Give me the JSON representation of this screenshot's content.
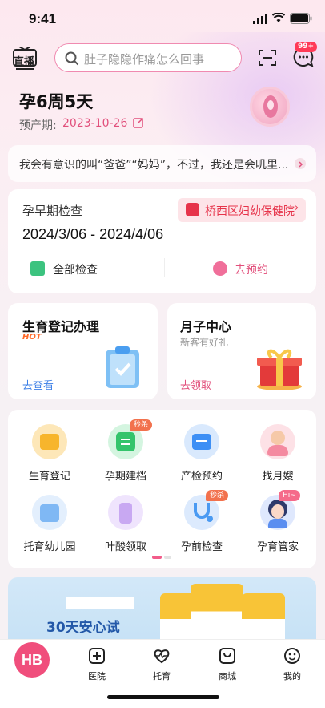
{
  "status_bar": {
    "time": "9:41"
  },
  "header": {
    "live_label": "直播",
    "search_placeholder": "肚子隐隐作痛怎么回事",
    "message_badge": "99+"
  },
  "pregnancy": {
    "week": "孕6周5天",
    "due_label": "预产期:",
    "due_date": "2023-10-26"
  },
  "tip": {
    "text": "我会有意识的叫“爸爸”“妈妈”，不过，我还是会叽里..."
  },
  "exam": {
    "title": "孕早期检查",
    "date_range": "2024/3/06 - 2024/4/06",
    "hospital": "桥西区妇幼保健院",
    "all_label": "全部检查",
    "book_label": "去预约"
  },
  "cards": [
    {
      "title": "生育登记办理",
      "tag": "HOT",
      "link": "去查看"
    },
    {
      "title": "月子中心",
      "subtitle": "新客有好礼",
      "link": "去领取"
    }
  ],
  "services": [
    {
      "label": "生育登记",
      "color": "#f7b52c",
      "icon": "registration-icon"
    },
    {
      "label": "孕期建档",
      "color": "#34c46b",
      "icon": "archive-icon",
      "tag": "秒杀"
    },
    {
      "label": "产检预约",
      "color": "#3d8ff5",
      "icon": "calendar-icon"
    },
    {
      "label": "找月嫂",
      "color": "#f4a8b4",
      "icon": "nanny-icon"
    },
    {
      "label": "托育幼儿园",
      "color": "#7fb8f4",
      "icon": "kindergarten-icon"
    },
    {
      "label": "叶酸领取",
      "color": "#c8a8f2",
      "icon": "folic-acid-icon"
    },
    {
      "label": "孕前检查",
      "color": "#4a9af2",
      "icon": "stethoscope-icon",
      "tag": "秒杀"
    },
    {
      "label": "孕育管家",
      "color": "#5b8ef0",
      "icon": "assistant-icon",
      "tag": "Hi~"
    }
  ],
  "banner": {
    "text": "30天安心试"
  },
  "tabbar": {
    "logo": "HB",
    "items": [
      {
        "label": "医院",
        "icon": "hospital-icon"
      },
      {
        "label": "托育",
        "icon": "heart-pulse-icon"
      },
      {
        "label": "商城",
        "icon": "shop-icon"
      },
      {
        "label": "我的",
        "icon": "profile-icon"
      }
    ]
  },
  "colors": {
    "accent": "#e2507c",
    "badge": "#ff3a57",
    "hospital": "#e6334a"
  }
}
